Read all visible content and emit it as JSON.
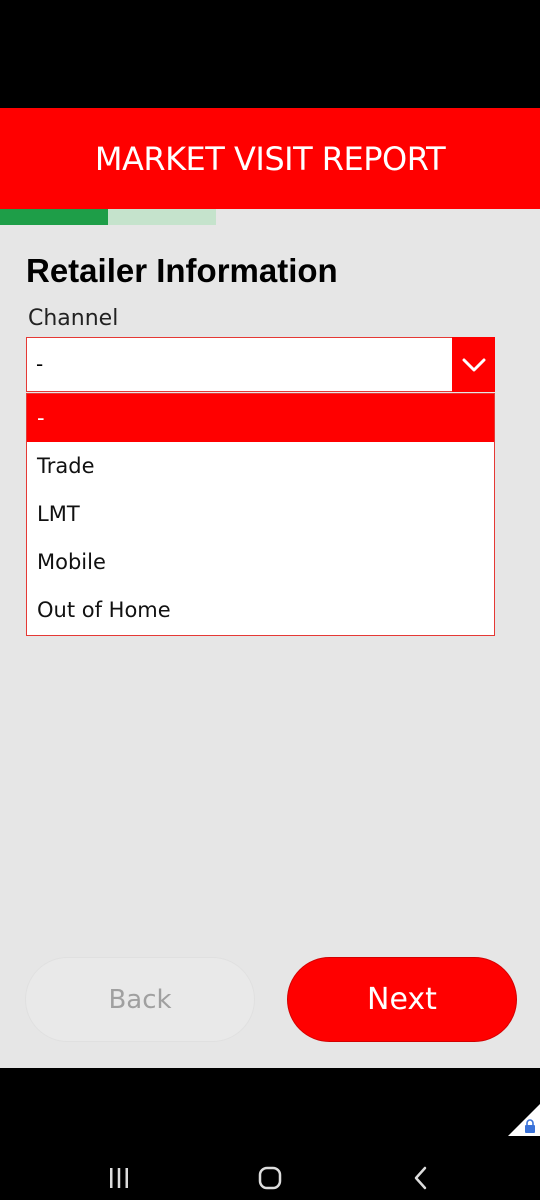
{
  "header": {
    "title": "MARKET VISIT REPORT"
  },
  "progress": {
    "fraction": 0.5
  },
  "section": {
    "title": "Retailer Information"
  },
  "channel": {
    "label": "Channel",
    "selected_value": "-",
    "options": [
      "-",
      "Trade",
      "LMT",
      "Mobile",
      "Out of Home"
    ]
  },
  "buttons": {
    "back_label": "Back",
    "next_label": "Next"
  },
  "colors": {
    "brand": "#ff0000",
    "progress_fill": "#1e9e48",
    "progress_track": "#c5e3cc"
  },
  "icons": {
    "select_arrow": "chevron-down-icon",
    "nav_recents": "recents-icon",
    "nav_home": "home-icon",
    "nav_back": "back-icon",
    "corner": "lock-icon"
  }
}
